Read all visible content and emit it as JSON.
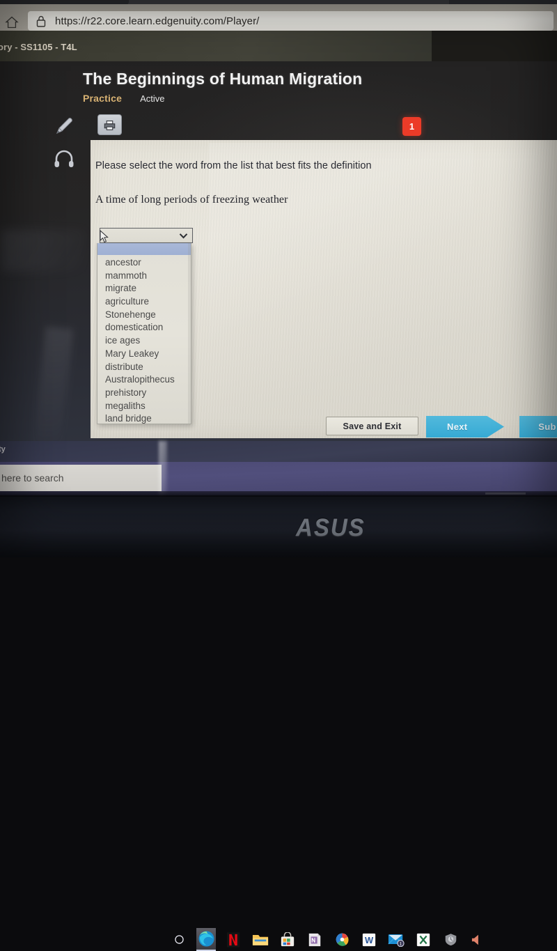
{
  "browser": {
    "home_icon": "home-icon",
    "lock_icon": "lock-icon",
    "url": "https://r22.core.learn.edgenuity.com/Player/",
    "tab_title": "ory - SS1105 - T4L"
  },
  "header": {
    "lesson_title": "The Beginnings of Human Migration",
    "tabs": [
      {
        "label": "Practice",
        "active": true,
        "color": "#d8b273"
      },
      {
        "label": "Active",
        "active": false,
        "color": "#e6e6e6"
      }
    ],
    "pencil_icon": "pencil-icon",
    "headphone_icon": "headphones-icon",
    "print_icon": "printer-icon",
    "question_badge": "1",
    "badge_color": "#ec3b28"
  },
  "question": {
    "prompt": "Please select the word from the list that best fits the definition",
    "definition": "A time of long periods of freezing weather",
    "selected_value": "",
    "chevron_icon": "chevron-down-icon",
    "cursor_icon": "cursor-arrow-icon",
    "options": [
      "",
      "ancestor",
      "mammoth",
      "migrate",
      "agriculture",
      "Stonehenge",
      "domestication",
      "ice ages",
      "Mary Leakey",
      "distribute",
      "Australopithecus",
      "prehistory",
      "megaliths",
      "land bridge"
    ]
  },
  "footer": {
    "save_and_exit_label": "Save and Exit",
    "next_label": "Next",
    "submit_label": "Sub",
    "accent_color": "#36aad4"
  },
  "taskbar": {
    "above_text": "ty",
    "search_placeholder": "here to search",
    "icons": [
      {
        "name": "cortana-circle-icon",
        "glyph": "○",
        "active": false
      },
      {
        "name": "edge-browser-icon",
        "glyph": "",
        "active": true
      },
      {
        "name": "netflix-icon",
        "glyph": "N",
        "active": false
      },
      {
        "name": "file-explorer-icon",
        "glyph": "",
        "active": false
      },
      {
        "name": "microsoft-store-icon",
        "glyph": "",
        "active": false
      },
      {
        "name": "onenote-icon",
        "glyph": "",
        "active": false
      },
      {
        "name": "photos-icon",
        "glyph": "",
        "active": false
      },
      {
        "name": "word-icon",
        "glyph": "W",
        "active": false
      },
      {
        "name": "mail-icon",
        "glyph": "",
        "active": false
      },
      {
        "name": "excel-icon",
        "glyph": "X",
        "active": false
      },
      {
        "name": "security-shield-icon",
        "glyph": "",
        "active": false
      },
      {
        "name": "volume-speaker-icon",
        "glyph": "",
        "active": false
      }
    ]
  },
  "device": {
    "brand_logo": "ASUS"
  }
}
